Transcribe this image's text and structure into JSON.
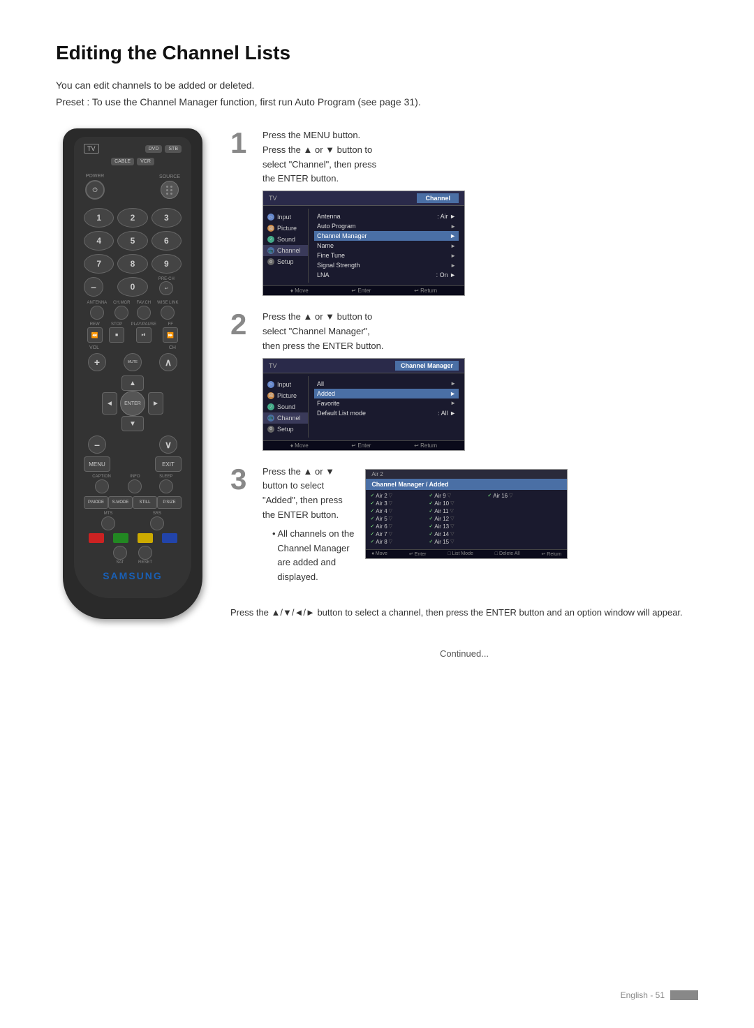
{
  "page": {
    "title": "Editing the Channel Lists",
    "intro1": "You can edit channels to be added or deleted.",
    "intro2": "Preset : To use the Channel Manager function, first run Auto Program (see page 31).",
    "footer": "English - 51"
  },
  "steps": [
    {
      "number": "1",
      "lines": [
        "Press the MENU button.",
        "Press the ▲ or ▼ button to",
        "select \"Channel\", then press",
        "the ENTER button."
      ]
    },
    {
      "number": "2",
      "lines": [
        "Press the ▲ or ▼ button to",
        "select \"Channel Manager\",",
        "then press the ENTER button."
      ]
    },
    {
      "number": "3",
      "lines": [
        "Press the ▲ or ▼",
        "button to select",
        "\"Added\", then press",
        "the ENTER button."
      ],
      "bullet": "All channels on the Channel Manager are added and displayed."
    }
  ],
  "bottom_note": "Press the ▲/▼/◄/► button to select a channel, then press the ENTER button and an option window will appear.",
  "continued": "Continued...",
  "screens": {
    "screen1": {
      "tv_label": "TV",
      "title": "Channel",
      "sidebar": [
        "Input",
        "Picture",
        "Sound",
        "Channel",
        "Setup"
      ],
      "menu_items": [
        {
          "label": "Antenna",
          "value": ": Air",
          "arrow": true
        },
        {
          "label": "Auto Program",
          "arrow": true
        },
        {
          "label": "Channel Manager",
          "arrow": true,
          "highlight": true
        },
        {
          "label": "Name",
          "arrow": true
        },
        {
          "label": "Fine Tune",
          "arrow": true
        },
        {
          "label": "Signal Strength",
          "arrow": true
        },
        {
          "label": "LNA",
          "value": ": On",
          "arrow": true
        }
      ],
      "footer": [
        "Move",
        "Enter",
        "Return"
      ]
    },
    "screen2": {
      "tv_label": "TV",
      "title": "Channel Manager",
      "sidebar": [
        "Input",
        "Picture",
        "Sound",
        "Channel",
        "Setup"
      ],
      "menu_items": [
        {
          "label": "All",
          "arrow": true
        },
        {
          "label": "Added",
          "arrow": true,
          "highlight": true
        },
        {
          "label": "Favorite",
          "arrow": true
        },
        {
          "label": "Default List mode",
          "value": ": All",
          "arrow": true
        }
      ],
      "footer": [
        "Move",
        "Enter",
        "Return"
      ]
    },
    "screen3": {
      "title": "Channel Manager / Added",
      "current": "Air 2",
      "channels_col1": [
        "Air 2",
        "Air 3",
        "Air 4",
        "Air 5",
        "Air 6",
        "Air 7",
        "Air 8"
      ],
      "channels_col2": [
        "Air 9",
        "Air 10",
        "Air 11",
        "Air 12",
        "Air 13",
        "Air 14",
        "Air 15"
      ],
      "channels_col3": [
        "Air 16"
      ],
      "footer": [
        "Move",
        "Enter",
        "List Mode",
        "Delete All",
        "Return"
      ]
    }
  },
  "remote": {
    "tv_label": "TV",
    "buttons": {
      "dvd": "DVD",
      "stb": "STB",
      "cable": "CABLE",
      "vcr": "VCR",
      "power_label": "POWER",
      "source": "SOURCE",
      "pre_ch": "PRE-CH",
      "antenna": "ANTENNA",
      "ch_mgr": "CH.MGR",
      "fav_ch": "FAV.CH",
      "wise_link": "WISE LINK",
      "rew": "REW",
      "stop": "STOP",
      "play_pause": "PLAY/PAUSE",
      "ff": "FF",
      "vol": "VOL",
      "ch": "CH",
      "mute": "MUTE",
      "menu": "MENU",
      "exit": "EXIT",
      "caption": "CAPTION",
      "info": "INFO",
      "sleep": "SLEEP",
      "p_mode": "P.MODE",
      "s_mode": "S.MODE",
      "still": "STILL",
      "p_size": "P.SIZE",
      "mts": "MTS",
      "srs": "SRS",
      "sat": "SAT",
      "reset": "RESET",
      "enter": "ENTER",
      "samsung": "SAMSUNG",
      "numbers": [
        "1",
        "2",
        "3",
        "4",
        "5",
        "6",
        "7",
        "8",
        "9",
        "0"
      ]
    }
  }
}
